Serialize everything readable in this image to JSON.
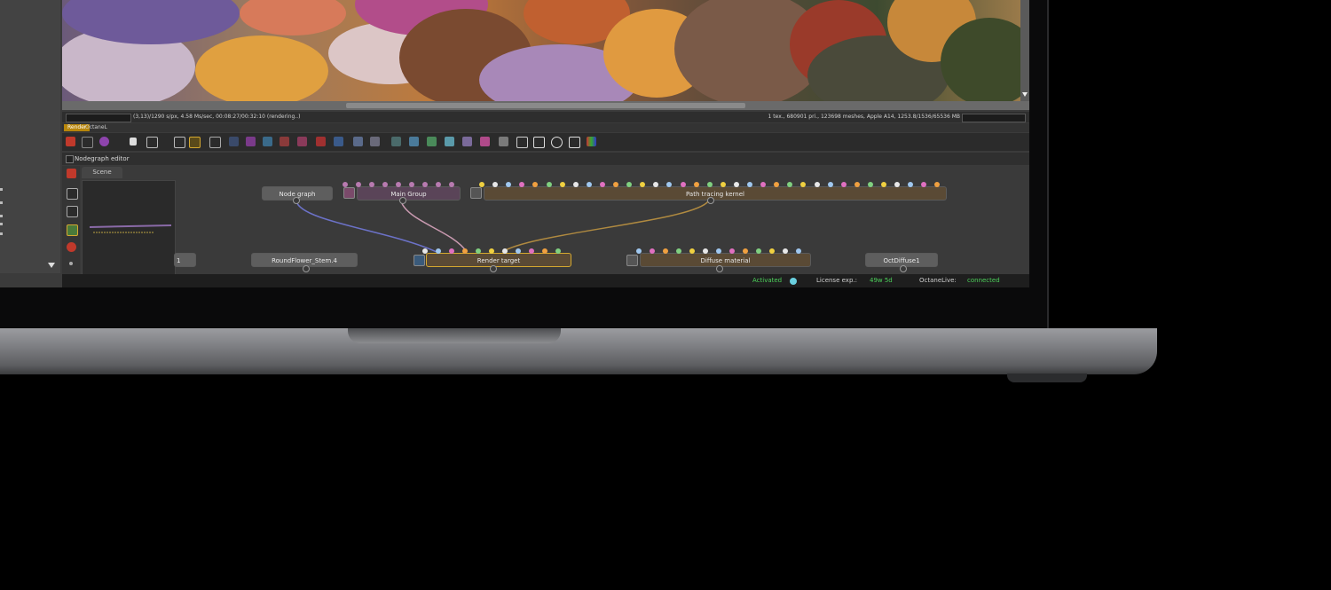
{
  "viewport": {
    "status_left": "(3,13)/1290 s/px, 4.58 Ms/sec, 00:08:27/00:32:10 (rendering..)",
    "status_right": "1 tex., 680901 pri., 123698 meshes, Apple A14, 1253.8/1536/65536 MB"
  },
  "render_tabs": {
    "active": "Render",
    "other": "OctaneL"
  },
  "nodegraph": {
    "title": "Nodegraph editor",
    "scene_tab": "Scene",
    "nodes": {
      "node_graph": "Node graph",
      "main_group": "Main Group",
      "path_tracing": "Path tracing kernel",
      "partial_left": "1",
      "round_flower": "RoundFlower_Stem.4",
      "render_target": "Render target",
      "diffuse_material": "Diffuse material",
      "oct_diffuse": "OctDiffuse1"
    }
  },
  "footer": {
    "activated": "Activated",
    "license_label": "License exp.:",
    "license_value": "49w 5d",
    "octanelive_label": "OctaneLive:",
    "octanelive_value": "connected"
  },
  "colors": {
    "status_green": "#4cd05a",
    "tab_active": "#b8860b",
    "wire_blue": "#6c72c8",
    "wire_pink": "#c99ab0",
    "wire_orange": "#b08a40"
  }
}
